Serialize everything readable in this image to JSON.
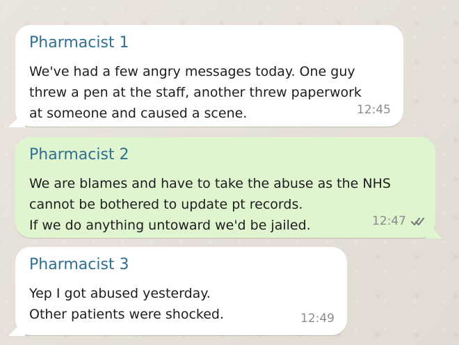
{
  "messages": [
    {
      "sender": "Pharmacist 1",
      "lines": [
        "We've had a few angry messages today. One guy",
        "threw a pen at the staff, another threw paperwork",
        "at someone and caused a scene."
      ],
      "time": "12:45"
    },
    {
      "sender": "Pharmacist 2",
      "lines": [
        "We are blames and have to take the abuse as the NHS",
        "cannot be bothered to update pt records.",
        "If we do anything untoward we'd be jailed."
      ],
      "time": "12:47",
      "status_icon": "double-check-icon"
    },
    {
      "sender": "Pharmacist 3",
      "lines": [
        "Yep I got abused yesterday.",
        "Other patients were shocked."
      ],
      "time": "12:49"
    }
  ],
  "colors": {
    "sender_name": "#2f6f8f",
    "incoming_bubble": "#ffffff",
    "outgoing_bubble": "#dff5cf",
    "timestamp": "#8b8b8b",
    "background": "#e6e1da"
  }
}
